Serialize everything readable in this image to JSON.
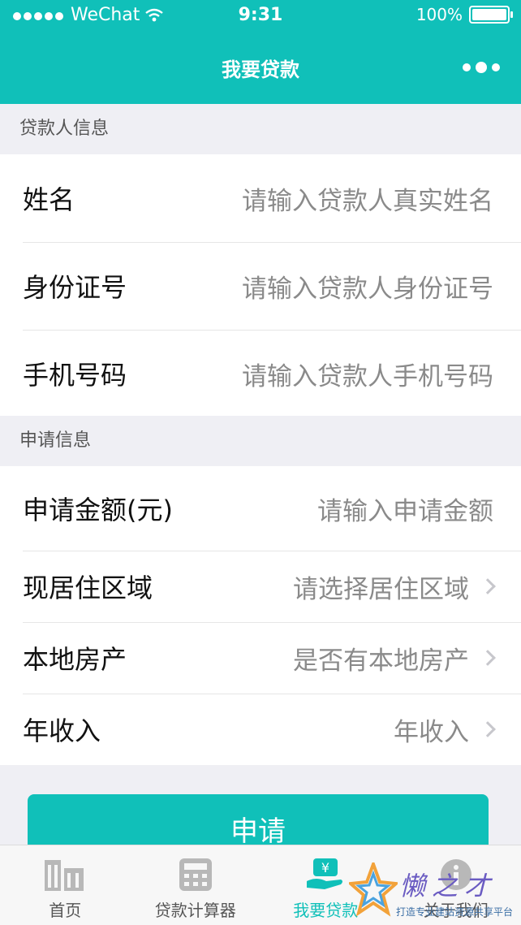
{
  "status_bar": {
    "carrier": "WeChat",
    "time": "9:31",
    "battery": "100%"
  },
  "nav": {
    "title": "我要贷款"
  },
  "sections": {
    "borrower_title": "贷款人信息",
    "apply_title": "申请信息"
  },
  "borrower": {
    "name_label": "姓名",
    "name_placeholder": "请输入贷款人真实姓名",
    "id_label": "身份证号",
    "id_placeholder": "请输入贷款人身份证号",
    "phone_label": "手机号码",
    "phone_placeholder": "请输入贷款人手机号码"
  },
  "application": {
    "amount_label": "申请金额(元)",
    "amount_placeholder": "请输入申请金额",
    "area_label": "现居住区域",
    "area_placeholder": "请选择居住区域",
    "property_label": "本地房产",
    "property_placeholder": "是否有本地房产",
    "income_label": "年收入",
    "income_placeholder": "年收入"
  },
  "apply_button": "申请",
  "tabbar": {
    "items": [
      {
        "label": "首页",
        "icon": "building-icon"
      },
      {
        "label": "贷款计算器",
        "icon": "calculator-icon"
      },
      {
        "label": "我要贷款",
        "icon": "money-icon"
      },
      {
        "label": "关于我们",
        "icon": "info-icon"
      }
    ],
    "active_index": 2,
    "active_color": "#10c0b9"
  },
  "theme": {
    "primary": "#10c0b9"
  },
  "watermark": {
    "text": "懒之才",
    "subtitle": "打造专业建站资源共享平台"
  }
}
